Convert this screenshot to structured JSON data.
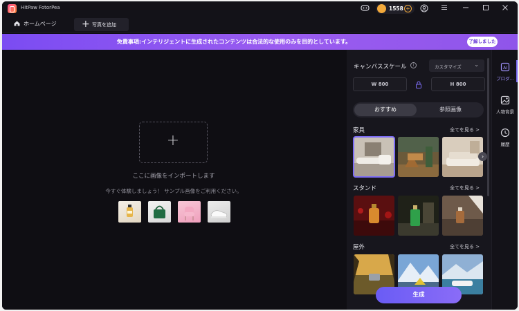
{
  "app": {
    "title": "HitPaw FotorPea"
  },
  "credits": {
    "count": "1558",
    "plus": "+"
  },
  "tabs": {
    "home": "ホームページ",
    "add_photo": "写真を追加",
    "add_plus": "+"
  },
  "banner": {
    "text": "免責事項:インテリジェントに生成されたコンテンツは合法的な使用のみを目的としています。",
    "button": "了解しました"
  },
  "canvas": {
    "drop_plus": "+",
    "import_hint": "ここに画像をインポートします",
    "sample_hint": "今すぐ体験しましょう！ サンプル画像をご利用ください。"
  },
  "panel": {
    "canvas_scale_label": "キャンバススケール",
    "info": "i",
    "preset": "カスタマイズ",
    "width": "W 800",
    "height": "H 800",
    "seg_recommended": "おすすめ",
    "seg_reference": "参照画像",
    "categories": [
      {
        "name": "家具",
        "see_all": "全てを見る >"
      },
      {
        "name": "スタンド",
        "see_all": "全てを見る >"
      },
      {
        "name": "屋外",
        "see_all": "全てを見る >"
      }
    ],
    "generate": "生成"
  },
  "rail": {
    "items": [
      {
        "label": "プロダ..."
      },
      {
        "label": "人物背景"
      },
      {
        "label": "履歴"
      }
    ]
  },
  "colors": {
    "accent": "#7c6cf5",
    "banner": "#8f55ea",
    "coin": "#f2a93b"
  }
}
